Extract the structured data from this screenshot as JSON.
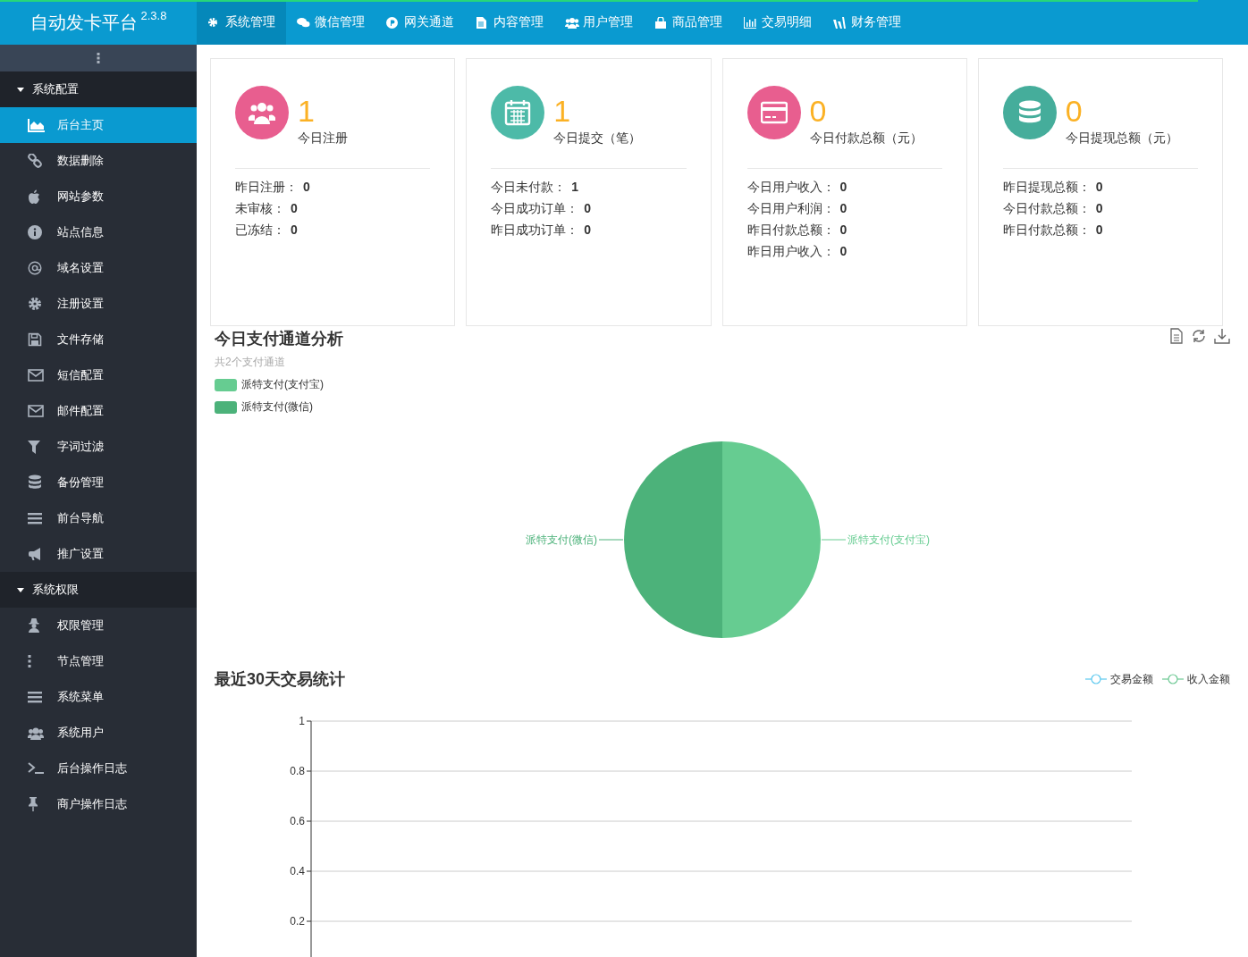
{
  "brand": {
    "title": "自动发卡平台",
    "version": "2.3.8"
  },
  "top_nav": [
    {
      "label": "系统管理",
      "selected": true
    },
    {
      "label": "微信管理",
      "selected": false
    },
    {
      "label": "网关通道",
      "selected": false
    },
    {
      "label": "内容管理",
      "selected": false
    },
    {
      "label": "用户管理",
      "selected": false
    },
    {
      "label": "商品管理",
      "selected": false
    },
    {
      "label": "交易明细",
      "selected": false
    },
    {
      "label": "财务管理",
      "selected": false
    }
  ],
  "sidebar": [
    {
      "label": "系统配置",
      "expanded": true,
      "items": [
        {
          "label": "后台主页",
          "selected": true
        },
        {
          "label": "数据删除",
          "selected": false
        },
        {
          "label": "网站参数",
          "selected": false
        },
        {
          "label": "站点信息",
          "selected": false
        },
        {
          "label": "域名设置",
          "selected": false
        },
        {
          "label": "注册设置",
          "selected": false
        },
        {
          "label": "文件存储",
          "selected": false
        },
        {
          "label": "短信配置",
          "selected": false
        },
        {
          "label": "邮件配置",
          "selected": false
        },
        {
          "label": "字词过滤",
          "selected": false
        },
        {
          "label": "备份管理",
          "selected": false
        },
        {
          "label": "前台导航",
          "selected": false
        },
        {
          "label": "推广设置",
          "selected": false
        }
      ]
    },
    {
      "label": "系统权限",
      "expanded": true,
      "items": [
        {
          "label": "权限管理",
          "selected": false
        },
        {
          "label": "节点管理",
          "selected": false
        },
        {
          "label": "系统菜单",
          "selected": false
        },
        {
          "label": "系统用户",
          "selected": false
        },
        {
          "label": "后台操作日志",
          "selected": false
        },
        {
          "label": "商户操作日志",
          "selected": false
        }
      ]
    }
  ],
  "stat_cards": [
    {
      "value": "1",
      "label": "今日注册",
      "color": "#e85e8f",
      "details": [
        {
          "label": "昨日注册：",
          "value": "0"
        },
        {
          "label": "未审核：",
          "value": "0"
        },
        {
          "label": "已冻结：",
          "value": "0"
        }
      ]
    },
    {
      "value": "1",
      "label": "今日提交（笔）",
      "color": "#4dbaa8",
      "details": [
        {
          "label": "今日未付款：",
          "value": "1"
        },
        {
          "label": "今日成功订单：",
          "value": "0"
        },
        {
          "label": "昨日成功订单：",
          "value": "0"
        }
      ]
    },
    {
      "value": "0",
      "label": "今日付款总额（元）",
      "color": "#e85e8f",
      "details": [
        {
          "label": "今日用户收入：",
          "value": "0"
        },
        {
          "label": "今日用户利润：",
          "value": "0"
        },
        {
          "label": "昨日付款总额：",
          "value": "0"
        },
        {
          "label": "昨日用户收入：",
          "value": "0"
        }
      ]
    },
    {
      "value": "0",
      "label": "今日提现总额（元）",
      "color": "#45ad9b",
      "details": [
        {
          "label": "昨日提现总额：",
          "value": "0"
        },
        {
          "label": "今日付款总额：",
          "value": "0"
        },
        {
          "label": "昨日付款总额：",
          "value": "0"
        }
      ]
    }
  ],
  "pie_panel": {
    "title": "今日支付通道分析",
    "subtitle": "共2个支付通道",
    "chart_data": {
      "type": "pie",
      "categories": [
        "派特支付(支付宝)",
        "派特支付(微信)"
      ],
      "values": [
        50,
        50
      ],
      "colors": [
        "#66cc91",
        "#4cb27a"
      ]
    }
  },
  "line_panel": {
    "title": "最近30天交易统计",
    "chart_data": {
      "type": "line",
      "grid": true,
      "ylim": [
        0,
        1
      ],
      "yticks": [
        0.2,
        0.4,
        0.6,
        0.8,
        1
      ],
      "series": [
        {
          "name": "交易金额",
          "color": "#5bc8ef"
        },
        {
          "name": "收入金额",
          "color": "#6cc893"
        }
      ]
    }
  }
}
